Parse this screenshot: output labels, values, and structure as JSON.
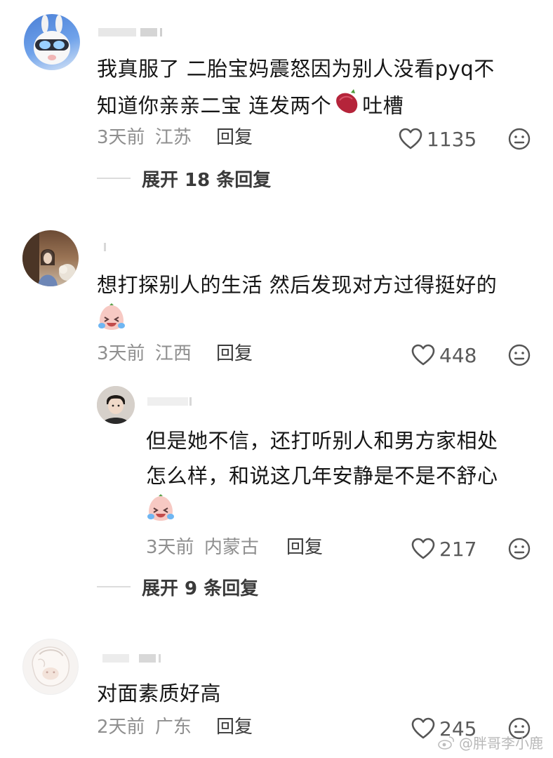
{
  "comments": [
    {
      "text_line1": "我真服了 二胎宝妈震怒因为别人没看pyq不",
      "text_line2": "知道你亲亲二宝 连发两个",
      "text_tail": "吐槽",
      "time": "3天前",
      "location": "江苏",
      "reply": "回复",
      "likes": "1135",
      "expand": "展开 18 条回复"
    },
    {
      "text_line1": "想打探别人的生活 然后发现对方过得挺好的",
      "time": "3天前",
      "location": "江西",
      "reply": "回复",
      "likes": "448"
    },
    {
      "text_line1": "但是她不信，还打听别人和男方家相处",
      "text_line2": "怎么样，和说这几年安静是不是不舒心",
      "time": "3天前",
      "location": "内蒙古",
      "reply": "回复",
      "likes": "217",
      "expand": "展开 9 条回复"
    },
    {
      "text_line1": "对面素质好高",
      "time": "2天前",
      "location": "广东",
      "reply": "回复",
      "likes": "245"
    }
  ],
  "watermark": "@胖哥李小鹿",
  "icons": {
    "like": "heart-outline-icon",
    "dislike": "meh-face-icon",
    "sweet_potato": "sweet-potato-emoji",
    "crying_face": "laugh-cry-emoji"
  },
  "colors": {
    "meta": "#8f8f8f",
    "text": "#161616",
    "line": "#dcdcdc"
  }
}
